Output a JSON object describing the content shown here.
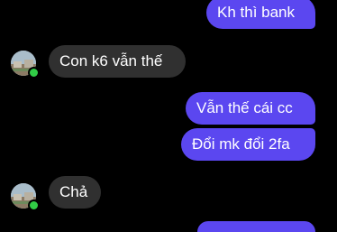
{
  "conversation": {
    "messages": [
      {
        "direction": "outgoing",
        "text": "Kh thì bank"
      },
      {
        "direction": "incoming",
        "text": "Con k6 vẫn thế"
      },
      {
        "direction": "outgoing",
        "text": "Vẫn thế cái cc"
      },
      {
        "direction": "outgoing",
        "text": "Đổi mk đổi 2fa"
      },
      {
        "direction": "incoming",
        "text": "Chả"
      },
      {
        "direction": "outgoing",
        "text": ""
      }
    ]
  },
  "colors": {
    "background": "#000000",
    "outgoing_bubble": "#5b47f0",
    "incoming_bubble": "#303030",
    "presence_online": "#31cc46"
  },
  "icons": {
    "avatar": "contact-avatar-photo",
    "status": "online-status-dot"
  }
}
